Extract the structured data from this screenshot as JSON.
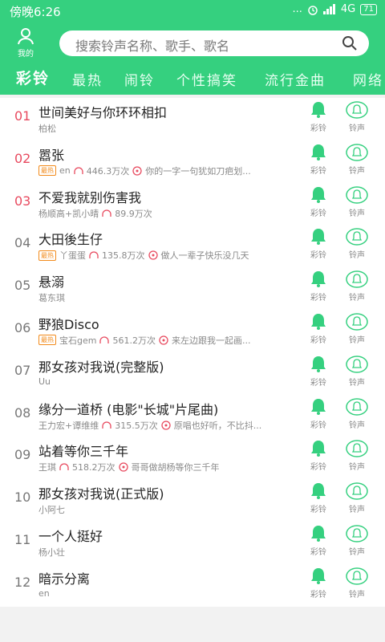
{
  "status_bar": {
    "time": "傍晚6:26",
    "signal_dots": "...",
    "network": "4G",
    "battery": "71"
  },
  "header": {
    "user_label": "我的",
    "search_placeholder": "搜索铃声名称、歌手、歌名",
    "tabs": [
      "彩铃",
      "最热",
      "闹铃",
      "个性搞笑",
      "流行金曲",
      "网络"
    ]
  },
  "colors": {
    "brand_green": "#35d07f",
    "rank_red": "#e84a5f",
    "hot_orange": "#f28a1a"
  },
  "actions": {
    "bell_label": "彩铃",
    "ring_label": "铃声"
  },
  "songs": [
    {
      "rank": "01",
      "title": "世间美好与你环环相扣",
      "artist": "柏松",
      "hot": "",
      "plays": "",
      "comment": ""
    },
    {
      "rank": "02",
      "title": "嚣张",
      "artist": "en",
      "hot": "最热",
      "plays": "446.3万次",
      "comment": "你的一字一句犹如刀疤划..."
    },
    {
      "rank": "03",
      "title": "不爱我就别伤害我",
      "artist": "杨顺高+凯小晴",
      "hot": "",
      "plays": "89.9万次",
      "comment": ""
    },
    {
      "rank": "04",
      "title": "大田後生仔",
      "artist": "丫蛋蛋",
      "hot": "最热",
      "plays": "135.8万次",
      "comment": "做人一辈子快乐没几天"
    },
    {
      "rank": "05",
      "title": "悬溺",
      "artist": "葛东琪",
      "hot": "",
      "plays": "",
      "comment": ""
    },
    {
      "rank": "06",
      "title": "野狼Disco",
      "artist": "宝石gem",
      "hot": "最热",
      "plays": "561.2万次",
      "comment": "来左边跟我一起画..."
    },
    {
      "rank": "07",
      "title": "那女孩对我说(完整版)",
      "artist": "Uu",
      "hot": "",
      "plays": "",
      "comment": ""
    },
    {
      "rank": "08",
      "title": "缘分一道桥 (电影\"长城\"片尾曲)",
      "artist": "王力宏+谭维维",
      "hot": "",
      "plays": "315.5万次",
      "comment": "原唱也好听，不比抖..."
    },
    {
      "rank": "09",
      "title": "站着等你三千年",
      "artist": "王琪",
      "hot": "",
      "plays": "518.2万次",
      "comment": "哥哥做胡杨等你三千年"
    },
    {
      "rank": "10",
      "title": "那女孩对我说(正式版)",
      "artist": "小阿七",
      "hot": "",
      "plays": "",
      "comment": ""
    },
    {
      "rank": "11",
      "title": "一个人挺好",
      "artist": "杨小壮",
      "hot": "",
      "plays": "",
      "comment": ""
    },
    {
      "rank": "12",
      "title": "暗示分离",
      "artist": "en",
      "hot": "",
      "plays": "",
      "comment": ""
    }
  ]
}
